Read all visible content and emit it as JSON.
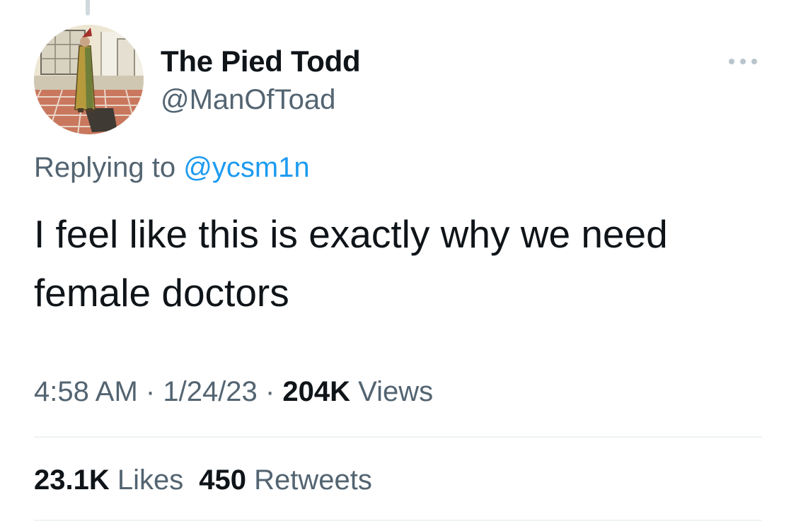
{
  "tweet": {
    "author": {
      "display_name": "The Pied Todd",
      "handle": "@ManOfToad",
      "avatar_icon": "profile-picture-painting"
    },
    "more_icon": "more-horizontal-icon",
    "reply": {
      "prefix": "Replying to",
      "mention": "@ycsm1n"
    },
    "text_lines": [
      "I feel like this is exactly why we need",
      "female doctors"
    ],
    "meta": {
      "time": "4:58 AM",
      "separator": "·",
      "date": "1/24/23",
      "views_count": "204K",
      "views_label": "Views"
    },
    "stats": {
      "likes_count": "23.1K",
      "likes_label": "Likes",
      "retweets_count": "450",
      "retweets_label": "Retweets"
    },
    "colors": {
      "text_primary": "#0f1419",
      "text_secondary": "#536471",
      "link": "#1d9bf0",
      "divider": "#eff3f4"
    }
  }
}
